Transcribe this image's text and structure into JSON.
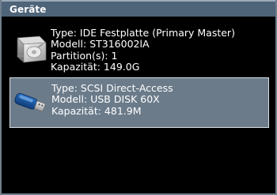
{
  "window": {
    "title": "Geräte"
  },
  "devices": [
    {
      "icon": "hard-disk-icon",
      "selected": false,
      "type_line": "Type: IDE Festplatte (Primary Master)",
      "model_line": "Modell: ST316002lA",
      "partitions_line": "Partition(s): 1",
      "capacity_line": "Kapazität: 149.0G"
    },
    {
      "icon": "usb-stick-icon",
      "selected": true,
      "type_line": "Type: SCSI Direct-Access",
      "model_line": "Modell: USB DISK 60X",
      "capacity_line": "Kapazität: 481.9M"
    }
  ]
}
